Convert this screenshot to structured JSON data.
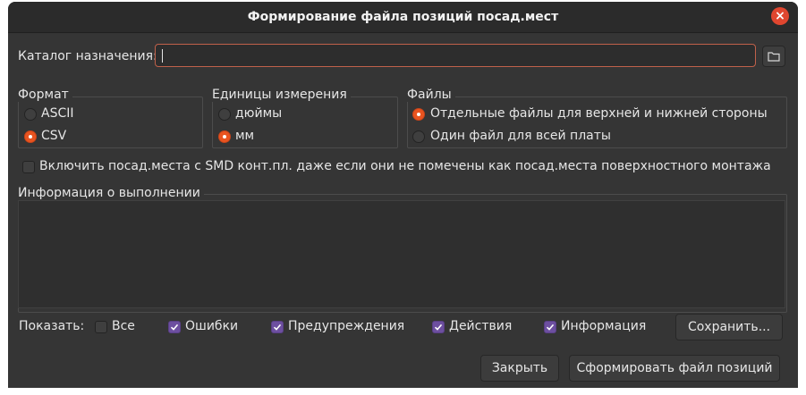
{
  "window": {
    "title": "Формирование файла позиций посад.мест",
    "close_icon": "×"
  },
  "destination": {
    "label": "Каталог назначения:",
    "value": "",
    "placeholder": ""
  },
  "format": {
    "title": "Формат",
    "options": [
      {
        "label": "ASCII",
        "selected": false
      },
      {
        "label": "CSV",
        "selected": true
      }
    ]
  },
  "units": {
    "title": "Единицы измерения",
    "options": [
      {
        "label": "дюймы",
        "selected": false
      },
      {
        "label": "мм",
        "selected": true
      }
    ]
  },
  "files": {
    "title": "Файлы",
    "options": [
      {
        "label": "Отдельные файлы для верхней и нижней стороны",
        "selected": true
      },
      {
        "label": "Один файл для всей платы",
        "selected": false
      }
    ]
  },
  "include_smd": {
    "label": "Включить посад.места с SMD конт.пл. даже если они не помечены как посад.места поверхностного монтажа",
    "checked": false
  },
  "messages": {
    "title": "Информация о выполнении",
    "content": ""
  },
  "filters": {
    "show_label": "Показать:",
    "all": {
      "label": "Все",
      "checked": false
    },
    "errors": {
      "label": "Ошибки",
      "checked": true
    },
    "warnings": {
      "label": "Предупреждения",
      "checked": true
    },
    "actions": {
      "label": "Действия",
      "checked": true
    },
    "info": {
      "label": "Информация",
      "checked": true
    },
    "save_label": "Сохранить..."
  },
  "footer": {
    "close_label": "Закрыть",
    "generate_label": "Сформировать файл позиций"
  },
  "colors": {
    "accent": "#e95420",
    "checkbox": "#6d4fa0",
    "close_button": "#e0462f",
    "background": "#353535"
  },
  "icons": {
    "folder": "folder-icon",
    "close": "close-icon",
    "check": "check-icon"
  }
}
